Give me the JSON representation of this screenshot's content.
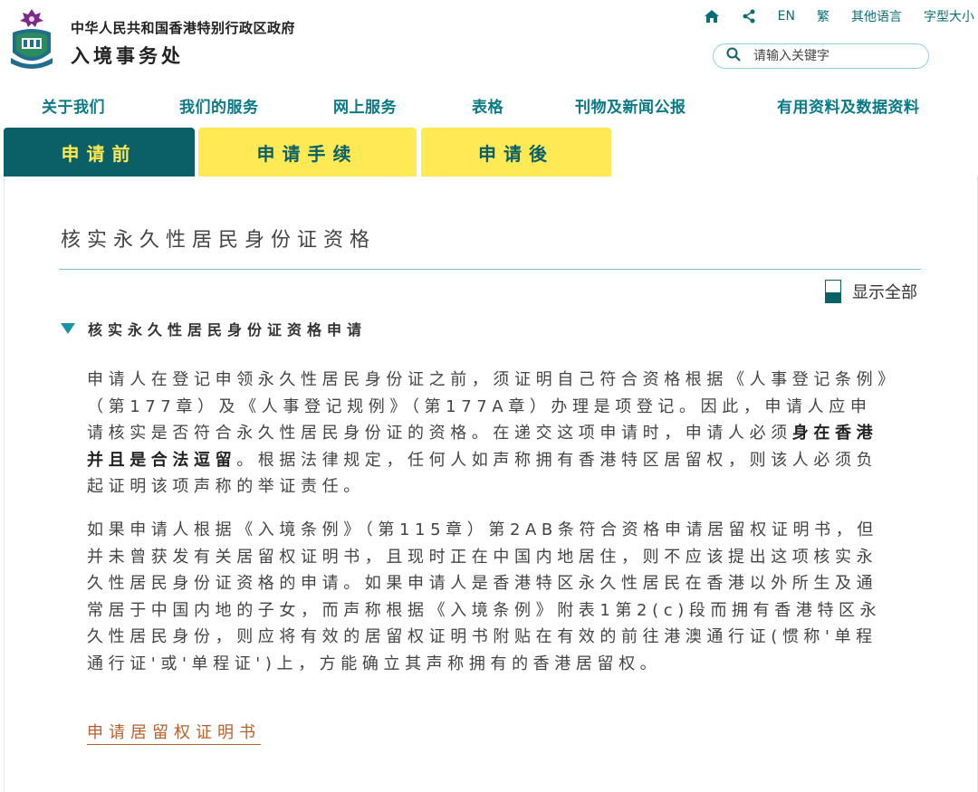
{
  "header": {
    "dept_top": "中华人民共和国香港特别行政区政府",
    "dept_main": "入境事务处",
    "top_links": {
      "en": "EN",
      "trad": "繁",
      "other_lang": "其他语言",
      "font_size": "字型大小"
    },
    "search": {
      "placeholder": "请输入关键字"
    }
  },
  "main_nav": [
    {
      "label": "关于我们"
    },
    {
      "label": "我们的服务"
    },
    {
      "label": "网上服务"
    },
    {
      "label": "表格"
    },
    {
      "label": "刊物及新闻公报"
    },
    {
      "label": "有用资料及数据资料"
    }
  ],
  "tabs": [
    {
      "label": "申请前",
      "active": true
    },
    {
      "label": "申请手续",
      "active": false
    },
    {
      "label": "申请後",
      "active": false
    }
  ],
  "content": {
    "title": "核实永久性居民身份证资格",
    "show_all": "显示全部",
    "accordion_title": "核实永久性居民身份证资格申请",
    "p1_a": "申请人在登记申领永久性居民身份证之前，须证明自己符合资格根据《人事登记条例》（第177章）及《人事登记规例》（第177A章）办理是项登记。因此，申请人应申请核实是否符合永久性居民身份证的资格。在递交这项申请时，申请人必须",
    "p1_bold": "身在香港并且是合法逗留",
    "p1_b": "。根据法律规定，任何人如声称拥有香港特区居留权，则该人必须负起证明该项声称的举证责任。",
    "p2": "如果申请人根据《入境条例》（第115章）第2AB条符合资格申请居留权证明书，但并未曾获发有关居留权证明书，且现时正在中国内地居住，则不应该提出这项核实永久性居民身份证资格的申请。如果申请人是香港特区永久性居民在香港以外所生及通常居于中国内地的子女，而声称根据《入境条例》附表1第2(c)段而拥有香港特区永久性居民身份，则应将有效的居留权证明书附贴在有效的前往港澳通行证(惯称'单程通行证'或'单程证')上，方能确立其声称拥有的香港居留权。",
    "link": "申请居留权证明书"
  },
  "colors": {
    "teal_dark": "#0b6068",
    "teal_nav": "#0a7a86",
    "yellow": "#ffea55",
    "link_orange": "#b8602e"
  }
}
